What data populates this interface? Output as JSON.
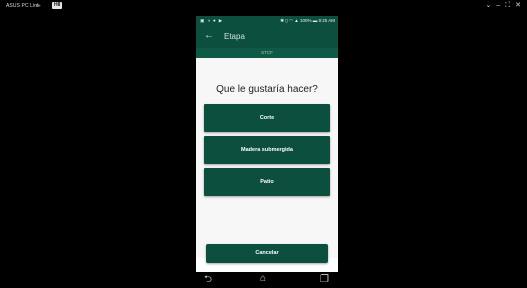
{
  "host": {
    "title": "ASUS PC Link",
    "usb_icon": "usb-icon",
    "tag": "H8",
    "controls": [
      "chevron-down-icon",
      "minimize-icon",
      "fullscreen-icon",
      "close-icon"
    ]
  },
  "phone": {
    "status_time": "9:25 AM",
    "battery": "100%",
    "appbar_title": "Etapa",
    "subheader": "STCF",
    "question": "Que le gustaría hacer?",
    "options": [
      {
        "label": "Corte"
      },
      {
        "label": "Madera submergida"
      },
      {
        "label": "Patio"
      }
    ],
    "cancel_label": "Cancelar",
    "colors": {
      "primary": "#0d4f3e",
      "background": "#f7f7f7"
    }
  }
}
